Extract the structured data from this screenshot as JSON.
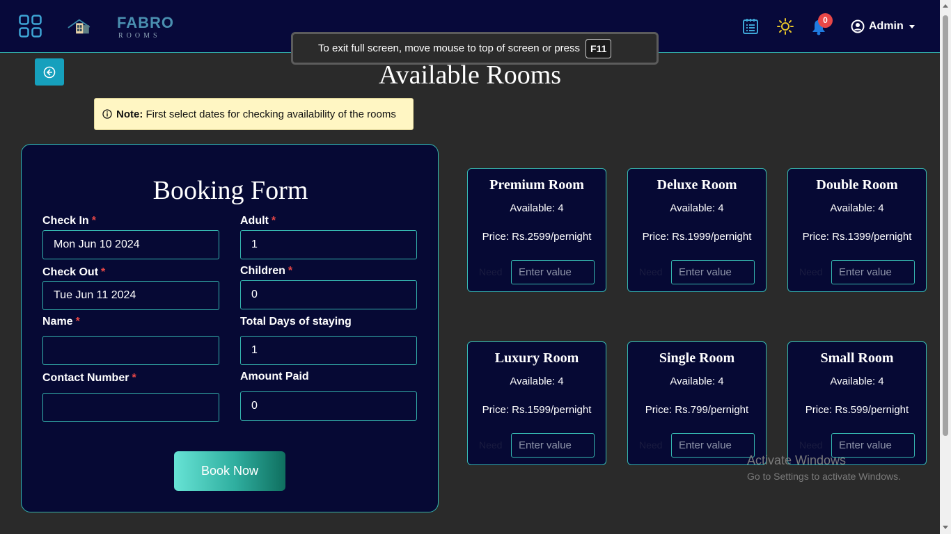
{
  "header": {
    "logo_title": "FABRO",
    "logo_subtitle": "ROOMS",
    "notification_count": "0",
    "user_label": "Admin"
  },
  "fullscreen_banner": {
    "text": "To exit full screen, move mouse to top of screen or press",
    "key": "F11"
  },
  "page": {
    "title": "Available Rooms"
  },
  "note": {
    "label": "Note:",
    "text": "First select dates for checking availability of the rooms"
  },
  "form": {
    "title": "Booking Form",
    "fields": {
      "check_in": {
        "label": "Check In",
        "value": "Mon Jun 10 2024"
      },
      "adult": {
        "label": "Adult",
        "value": "1"
      },
      "check_out": {
        "label": "Check Out",
        "value": "Tue Jun 11 2024"
      },
      "children": {
        "label": "Children",
        "value": "0"
      },
      "name": {
        "label": "Name",
        "value": ""
      },
      "total_days": {
        "label": "Total Days of staying",
        "value": "1"
      },
      "contact": {
        "label": "Contact Number",
        "value": ""
      },
      "amount_paid": {
        "label": "Amount Paid",
        "value": "0"
      }
    },
    "required_mark": "*",
    "submit_label": "Book Now"
  },
  "rooms": [
    {
      "name": "Premium Room",
      "available": "Available: 4",
      "price": "Price: Rs.2599/pernight",
      "need_label": "Need",
      "placeholder": "Enter value"
    },
    {
      "name": "Deluxe Room",
      "available": "Available: 4",
      "price": "Price: Rs.1999/pernight",
      "need_label": "Need",
      "placeholder": "Enter value"
    },
    {
      "name": "Double Room",
      "available": "Available: 4",
      "price": "Price: Rs.1399/pernight",
      "need_label": "Need",
      "placeholder": "Enter value"
    },
    {
      "name": "Luxury Room",
      "available": "Available: 4",
      "price": "Price: Rs.1599/pernight",
      "need_label": "Need",
      "placeholder": "Enter value"
    },
    {
      "name": "Single Room",
      "available": "Available: 4",
      "price": "Price: Rs.799/pernight",
      "need_label": "Need",
      "placeholder": "Enter value"
    },
    {
      "name": "Small Room",
      "available": "Available: 4",
      "price": "Price: Rs.599/pernight",
      "need_label": "Need",
      "placeholder": "Enter value"
    }
  ],
  "watermark": {
    "title": "Activate Windows",
    "subtitle": "Go to Settings to activate Windows."
  },
  "colors": {
    "navbar": "#07093a",
    "card": "#060934",
    "accent": "#35b7b0",
    "page_bg": "#2a2a2a",
    "badge": "#e84747",
    "note_bg": "#fff6c3"
  }
}
